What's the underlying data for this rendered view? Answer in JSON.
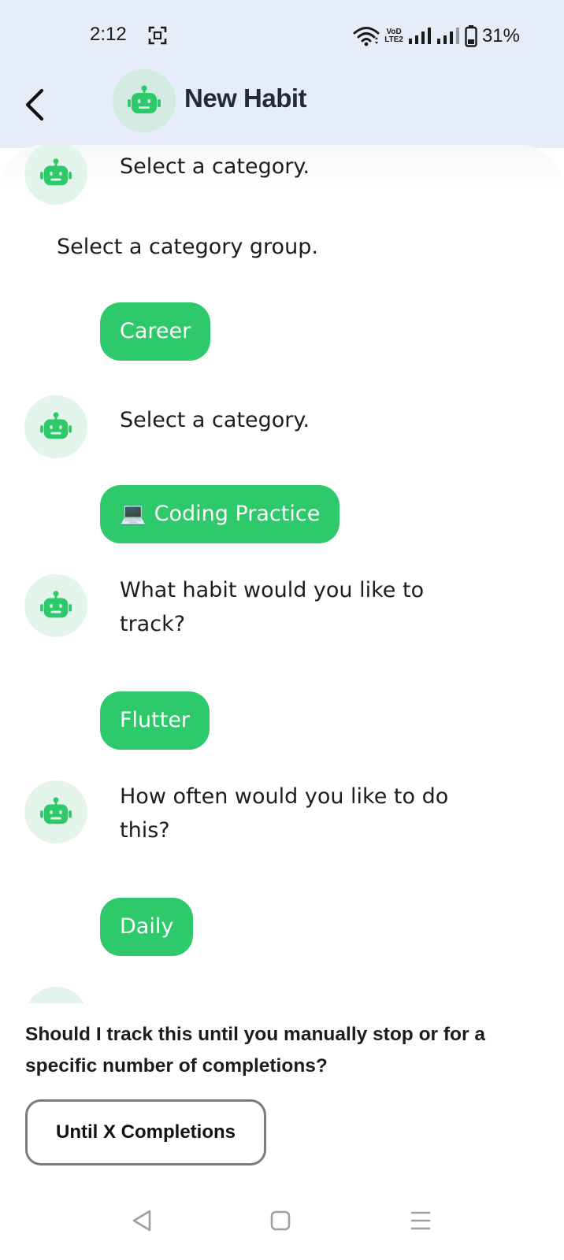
{
  "status_bar": {
    "time": "2:12",
    "volte_top": "VoD",
    "volte_bottom": "LTE2",
    "battery_percent": "31%"
  },
  "app_bar": {
    "title": "New Habit",
    "back_icon": "back-arrow-icon",
    "avatar_icon": "robot-icon"
  },
  "chat": {
    "messages": [
      {
        "from": "bot",
        "text": "Select a category."
      },
      {
        "from": "bot_plain",
        "text": "Select a category group."
      },
      {
        "from": "user",
        "text": "Career"
      },
      {
        "from": "bot",
        "text": "Select a category."
      },
      {
        "from": "user",
        "emoji": "💻",
        "text": "Coding Practice"
      },
      {
        "from": "bot",
        "text": "What habit would you like to track?"
      },
      {
        "from": "user",
        "text": "Flutter"
      },
      {
        "from": "bot",
        "text": "How often would you like to do this?"
      },
      {
        "from": "user",
        "text": "Daily"
      }
    ]
  },
  "bottom_panel": {
    "question": "Should I track this until you manually stop or for a specific number of completions?",
    "option_label": "Until X Completions"
  },
  "colors": {
    "header_bg": "#e6edf8",
    "accent_green": "#2ec96a",
    "avatar_bg": "#e3f5ea",
    "title_color": "#202a3c"
  }
}
